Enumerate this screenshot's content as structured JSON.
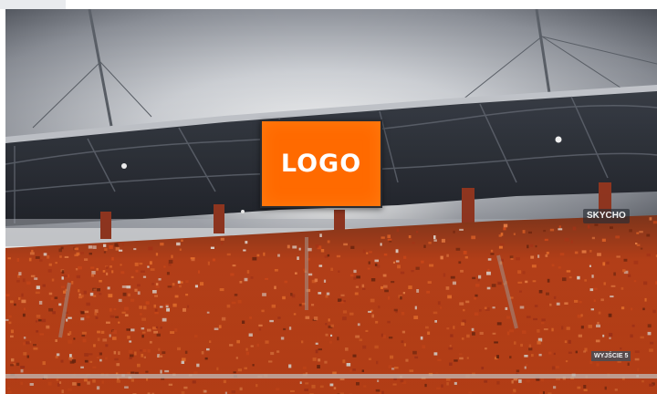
{
  "scene": {
    "description_tag": "stadium-photo",
    "colors": {
      "sky_light": "#e9ebee",
      "sky_dark": "#5a5e66",
      "roof": "#2c3038",
      "crowd_orange": "#e8531d",
      "crowd_dark": "#7a2a10",
      "screen_orange": "#ff6a00"
    }
  },
  "screen": {
    "logo_text": "LOGO"
  },
  "signage": {
    "right_banner": "SKYCHO",
    "bottom_sign": "WYJŚCIE 5"
  }
}
